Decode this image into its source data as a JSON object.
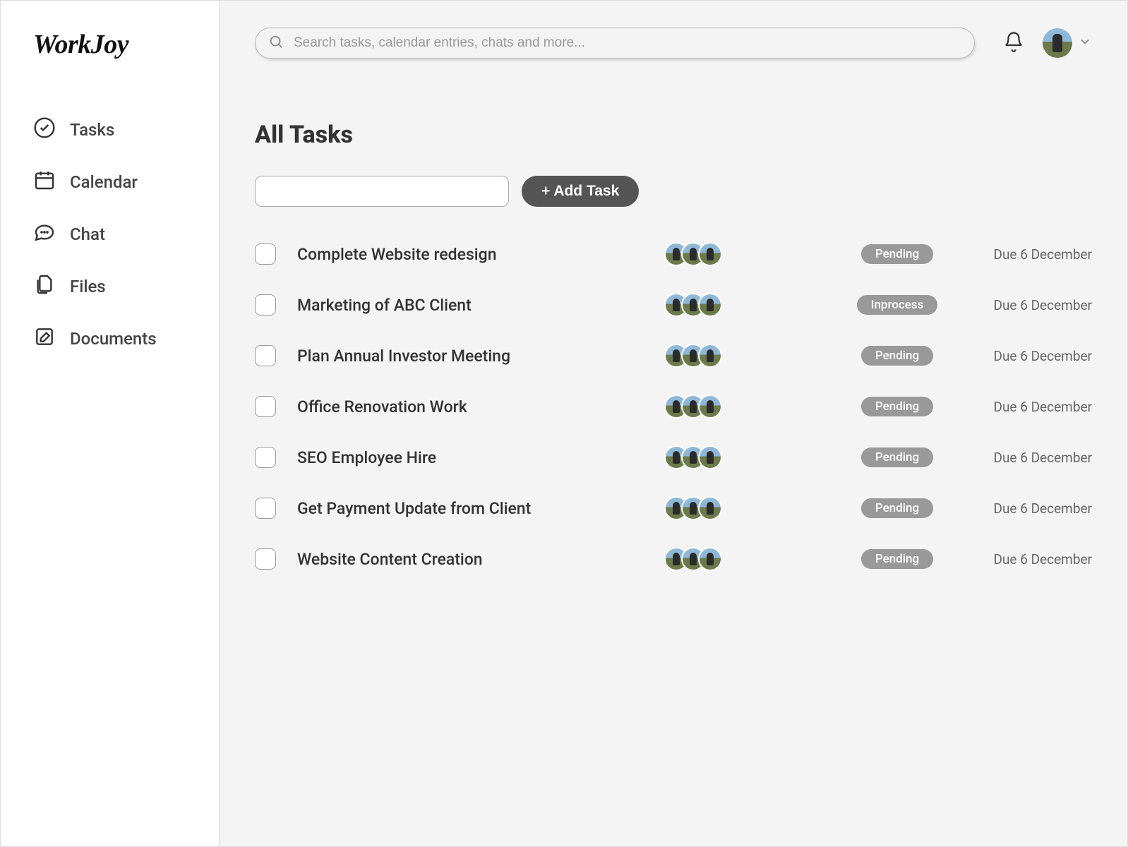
{
  "brand": "WorkJoy",
  "sidebar": {
    "items": [
      {
        "id": "tasks",
        "label": "Tasks"
      },
      {
        "id": "calendar",
        "label": "Calendar"
      },
      {
        "id": "chat",
        "label": "Chat"
      },
      {
        "id": "files",
        "label": "Files"
      },
      {
        "id": "documents",
        "label": "Documents"
      }
    ]
  },
  "search": {
    "placeholder": "Search tasks, calendar entries, chats and more..."
  },
  "page": {
    "title": "All Tasks",
    "add_button": "+ Add Task"
  },
  "tasks": [
    {
      "title": "Complete Website redesign",
      "status": "Pending",
      "due": "Due 6 December",
      "assignees": 3
    },
    {
      "title": "Marketing of ABC Client",
      "status": "Inprocess",
      "due": "Due 6 December",
      "assignees": 3
    },
    {
      "title": "Plan Annual Investor Meeting",
      "status": "Pending",
      "due": "Due 6 December",
      "assignees": 3
    },
    {
      "title": "Office Renovation Work",
      "status": "Pending",
      "due": "Due 6 December",
      "assignees": 3
    },
    {
      "title": "SEO Employee Hire",
      "status": "Pending",
      "due": "Due 6 December",
      "assignees": 3
    },
    {
      "title": "Get Payment Update from Client",
      "status": "Pending",
      "due": "Due 6 December",
      "assignees": 3
    },
    {
      "title": "Website Content Creation",
      "status": "Pending",
      "due": "Due 6 December",
      "assignees": 3
    }
  ]
}
